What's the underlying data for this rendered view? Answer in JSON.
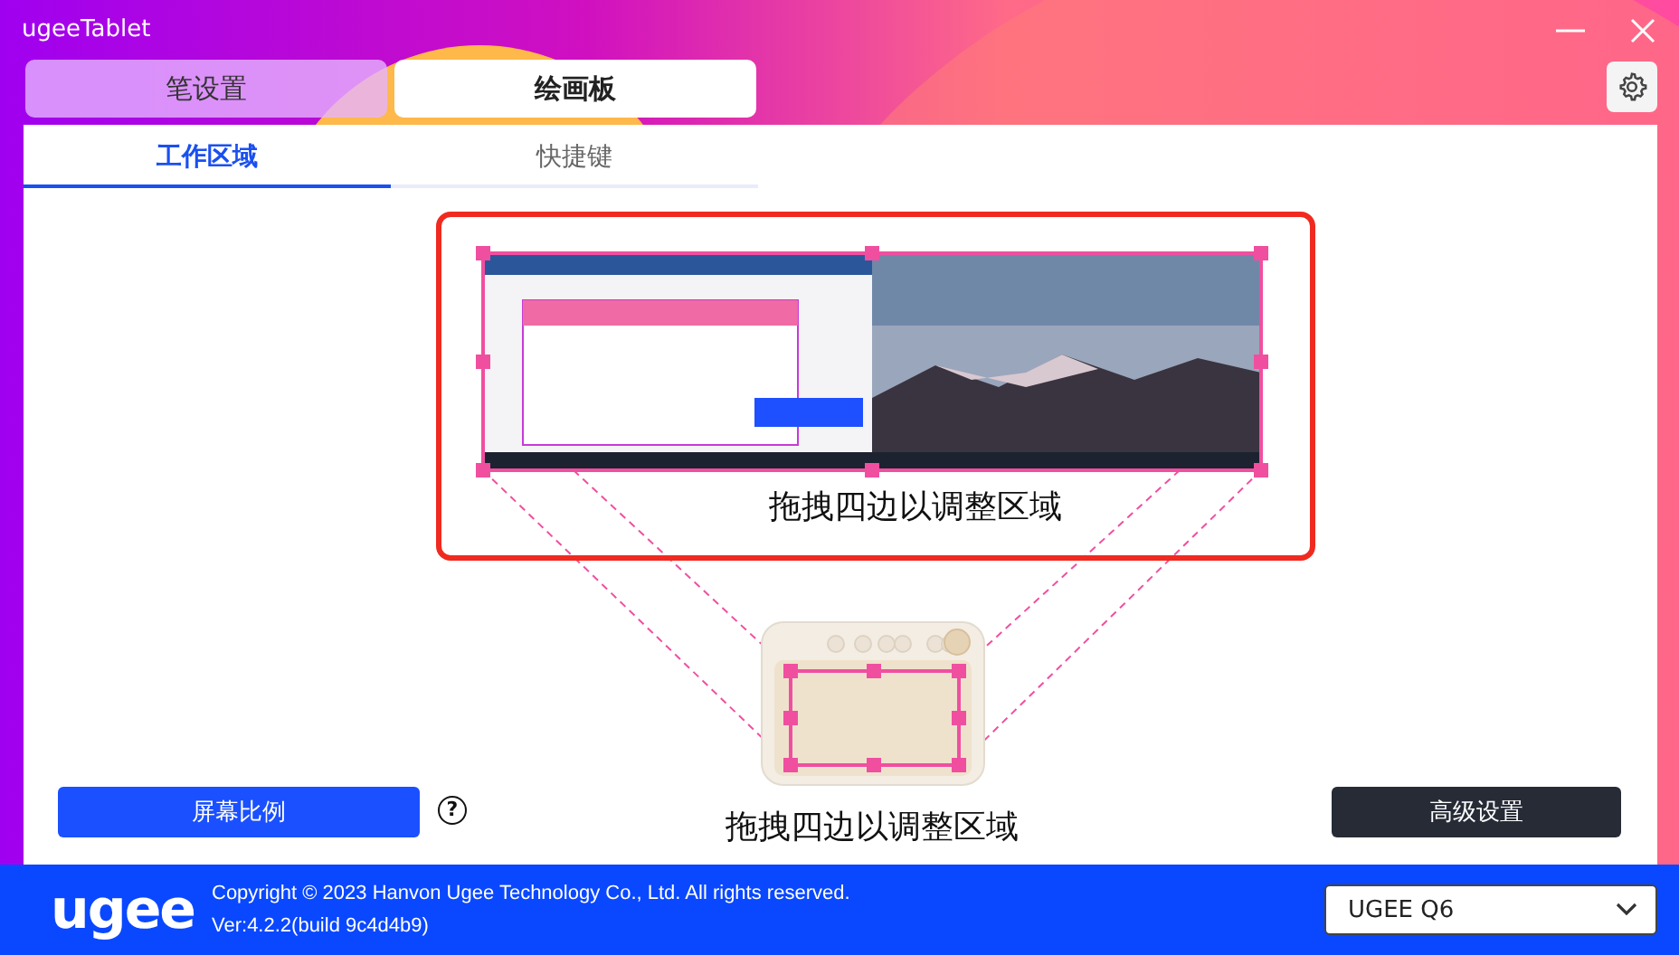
{
  "window": {
    "title": "ugeeTablet"
  },
  "top_tabs": [
    {
      "label": "笔设置",
      "selected": false
    },
    {
      "label": "绘画板",
      "selected": true
    }
  ],
  "sub_tabs": [
    {
      "label": "工作区域",
      "selected": true
    },
    {
      "label": "快捷键",
      "selected": false
    }
  ],
  "work_area": {
    "screen_caption": "拖拽四边以调整区域",
    "tablet_caption": "拖拽四边以调整区域"
  },
  "buttons": {
    "ratio": "屏幕比例",
    "help": "?",
    "advanced": "高级设置"
  },
  "footer": {
    "logo": "ugee",
    "copyright": "Copyright © 2023 Hanvon Ugee Technology Co., Ltd. All rights reserved.",
    "version": "Ver:4.2.2(build 9c4d4b9)",
    "device_select": {
      "value": "UGEE Q6"
    }
  }
}
